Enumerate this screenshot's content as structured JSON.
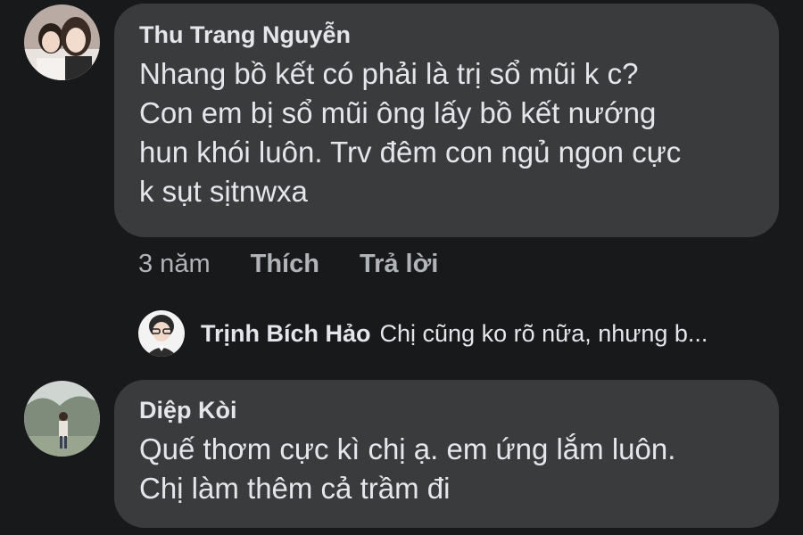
{
  "comments": [
    {
      "author": "Thu Trang Nguyễn",
      "text": "Nhang bồ kết có phải là trị sổ mũi k c?\nCon em bị sổ mũi ông lấy bồ kết nướng\nhun khói luôn. Trv đêm con ngủ ngon cực\nk sụt sịtnwxa",
      "time": "3 năm",
      "like_label": "Thích",
      "reply_label": "Trả lời",
      "reply_preview": {
        "author": "Trịnh Bích Hảo",
        "text": "Chị cũng ko rõ nữa, nhưng b..."
      }
    },
    {
      "author": "Diệp Kòi",
      "text": "Quế thơm cực kì chị ạ. em ứng lắm luôn.\nChị làm thêm cả trầm đi"
    }
  ],
  "colors": {
    "background": "#18191a",
    "bubble": "#3a3b3c",
    "primary_text": "#e4e6eb",
    "secondary_text": "#b0b3b8"
  }
}
